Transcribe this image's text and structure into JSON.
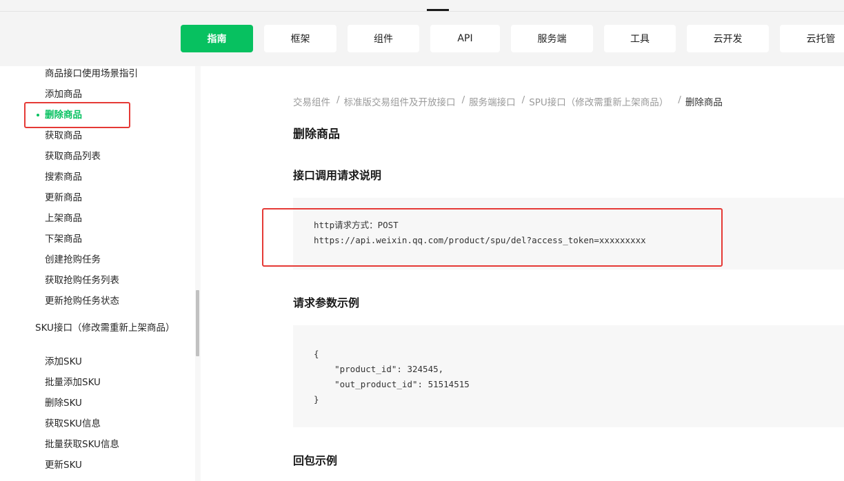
{
  "nav": {
    "tabs": [
      {
        "label": "指南",
        "active": true
      },
      {
        "label": "框架"
      },
      {
        "label": "组件"
      },
      {
        "label": "API"
      },
      {
        "label": "服务端"
      },
      {
        "label": "工具"
      },
      {
        "label": "云开发"
      },
      {
        "label": "云托管"
      }
    ]
  },
  "sidebar": {
    "items": [
      "商品接口使用场景指引",
      "添加商品",
      "删除商品",
      "获取商品",
      "获取商品列表",
      "搜索商品",
      "更新商品",
      "上架商品",
      "下架商品",
      "创建抢购任务",
      "获取抢购任务列表",
      "更新抢购任务状态"
    ],
    "group_title": "SKU接口（修改需重新上架商品）",
    "sku_items": [
      "添加SKU",
      "批量添加SKU",
      "删除SKU",
      "获取SKU信息",
      "批量获取SKU信息",
      "更新SKU"
    ]
  },
  "breadcrumb": {
    "items": [
      "交易组件",
      "标准版交易组件及开放接口",
      "服务端接口",
      "SPU接口（修改需重新上架商品）"
    ],
    "separator": "/",
    "current": "删除商品"
  },
  "main": {
    "title": "删除商品",
    "section1": "接口调用请求说明",
    "request_lines": [
      "http请求方式：POST",
      "https://api.weixin.qq.com/product/spu/del?access_token=xxxxxxxxx"
    ],
    "section2": "请求参数示例",
    "param_lines": [
      "{",
      "    \"product_id\": 324545,",
      "    \"out_product_id\": 51514515",
      "}"
    ],
    "section3": "回包示例"
  },
  "colors": {
    "accent": "#07c160",
    "highlight_box": "#e53935"
  }
}
